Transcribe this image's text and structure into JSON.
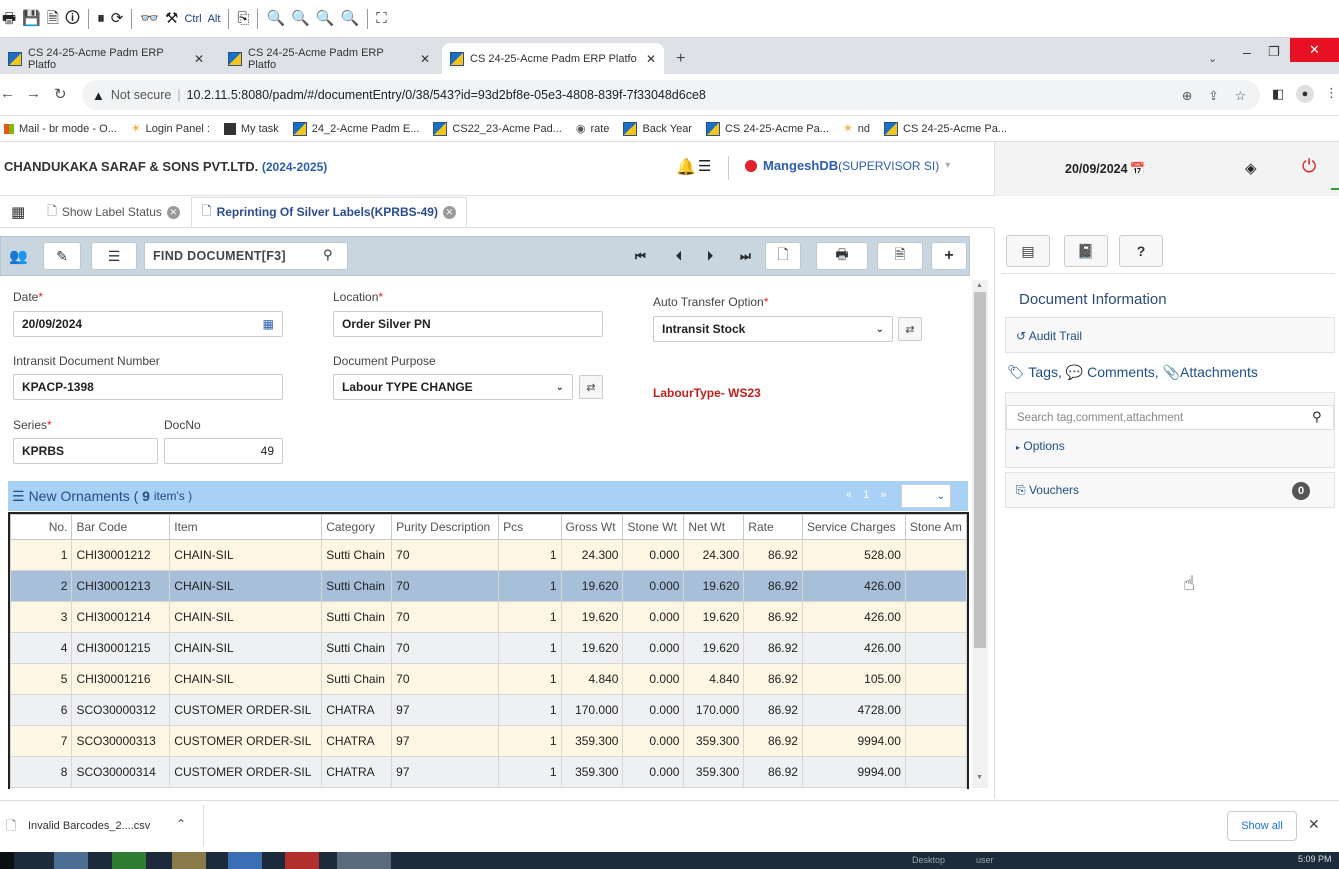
{
  "browser": {
    "tabs": [
      {
        "title": "CS 24-25-Acme Padm ERP Platfo"
      },
      {
        "title": "CS 24-25-Acme Padm ERP Platfo"
      },
      {
        "title": "CS 24-25-Acme Padm ERP Platfo"
      }
    ],
    "not_secure": "Not secure",
    "url": "10.2.11.5:8080/padm/#/documentEntry/0/38/543?id=93d2bf8e-05e3-4808-839f-7f33048d6ce8",
    "bookmarks": [
      "Mail - br mode - O...",
      "Login Panel :",
      "My task",
      "24_2-Acme Padm E...",
      "CS22_23-Acme Pad...",
      "rate",
      "Back Year",
      "CS 24-25-Acme Pa...",
      "nd",
      "CS 24-25-Acme Pa..."
    ],
    "toolbar_ctrl": "Ctrl",
    "toolbar_alt": "Alt"
  },
  "app": {
    "company": "CHANDUKAKA SARAF & SONS PVT.LTD.",
    "year": "(2024-2025)",
    "user": "MangeshDB",
    "role": "(SUPERVISOR SI)",
    "date": "20/09/2024"
  },
  "doc_tabs": [
    {
      "label": "Show Label Status"
    },
    {
      "label": "Reprinting Of Silver Labels(KPRBS-49)"
    }
  ],
  "toolbar": {
    "find_placeholder": "FIND DOCUMENT[F3]"
  },
  "form": {
    "date_label": "Date",
    "date_value": "20/09/2024",
    "location_label": "Location",
    "location_value": "Order Silver PN",
    "auto_transfer_label": "Auto Transfer Option",
    "auto_transfer_value": "Intransit Stock",
    "intransit_label": "Intransit Document Number",
    "intransit_value": "KPACP-1398",
    "purpose_label": "Document Purpose",
    "purpose_value": "Labour TYPE CHANGE",
    "labour_type": "LabourType- WS23",
    "series_label": "Series",
    "series_value": "KPRBS",
    "docno_label": "DocNo",
    "docno_value": "49"
  },
  "grid": {
    "title": "New Ornaments (",
    "count": "9",
    "count_suffix": "item's )",
    "pager": "« 1 »",
    "columns": [
      "No.",
      "Bar Code",
      "Item",
      "Category",
      "Purity Description",
      "Pcs",
      "Gross Wt",
      "Stone Wt",
      "Net Wt",
      "Rate",
      "Service Charges",
      "Stone Am"
    ],
    "rows": [
      [
        "1",
        "CHI30001212",
        "CHAIN-SIL",
        "Sutti Chain",
        "70",
        "1",
        "24.300",
        "0.000",
        "24.300",
        "86.92",
        "528.00",
        ""
      ],
      [
        "2",
        "CHI30001213",
        "CHAIN-SIL",
        "Sutti Chain",
        "70",
        "1",
        "19.620",
        "0.000",
        "19.620",
        "86.92",
        "426.00",
        ""
      ],
      [
        "3",
        "CHI30001214",
        "CHAIN-SIL",
        "Sutti Chain",
        "70",
        "1",
        "19.620",
        "0.000",
        "19.620",
        "86.92",
        "426.00",
        ""
      ],
      [
        "4",
        "CHI30001215",
        "CHAIN-SIL",
        "Sutti Chain",
        "70",
        "1",
        "19.620",
        "0.000",
        "19.620",
        "86.92",
        "426.00",
        ""
      ],
      [
        "5",
        "CHI30001216",
        "CHAIN-SIL",
        "Sutti Chain",
        "70",
        "1",
        "4.840",
        "0.000",
        "4.840",
        "86.92",
        "105.00",
        ""
      ],
      [
        "6",
        "SCO30000312",
        "CUSTOMER ORDER-SIL",
        "CHATRA",
        "97",
        "1",
        "170.000",
        "0.000",
        "170.000",
        "86.92",
        "4728.00",
        ""
      ],
      [
        "7",
        "SCO30000313",
        "CUSTOMER ORDER-SIL",
        "CHATRA",
        "97",
        "1",
        "359.300",
        "0.000",
        "359.300",
        "86.92",
        "9994.00",
        ""
      ],
      [
        "8",
        "SCO30000314",
        "CUSTOMER ORDER-SIL",
        "CHATRA",
        "97",
        "1",
        "359.300",
        "0.000",
        "359.300",
        "86.92",
        "9994.00",
        ""
      ]
    ]
  },
  "right_panel": {
    "doc_info": "Document Information",
    "audit_trail": "Audit Trail",
    "tags": "Tags, ",
    "comments": "Comments, ",
    "attachments": "Attachments",
    "search_placeholder": "Search tag,comment,attachment",
    "options": "Options",
    "vouchers": "Vouchers",
    "vouchers_count": "0"
  },
  "downloads": {
    "file": "Invalid Barcodes_2....csv",
    "show_all": "Show all"
  },
  "taskbar": {
    "time": "5:09 PM",
    "label1": "Desktop",
    "label2": "user"
  }
}
